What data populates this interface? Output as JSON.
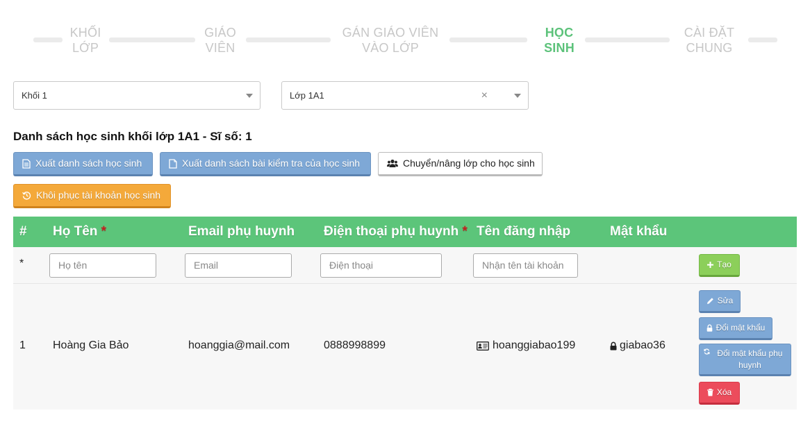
{
  "stepper": {
    "steps": [
      {
        "line1": "KHỐI",
        "line2": "LỚP"
      },
      {
        "line1": "GIÁO",
        "line2": "VIÊN"
      },
      {
        "line1": "GÁN GIÁO VIÊN",
        "line2": "VÀO LỚP"
      },
      {
        "line1": "HỌC",
        "line2": "SINH"
      },
      {
        "line1": "CÀI ĐẶT",
        "line2": "CHUNG"
      }
    ],
    "active_index": 3
  },
  "filters": {
    "grade_value": "Khối 1",
    "class_value": "Lớp 1A1",
    "clear_symbol": "×"
  },
  "list_title": "Danh sách học sinh khối lớp 1A1 - Sĩ số: 1",
  "toolbar": {
    "export_students": "Xuất danh sách học sinh",
    "export_tests": "Xuất danh sách bài kiểm tra của học sinh",
    "move_class": "Chuyển/nâng lớp cho học sinh",
    "restore_accounts": "Khôi phục tài khoản học sinh"
  },
  "table": {
    "headers": {
      "index": "#",
      "name": "Họ Tên",
      "email": "Email phụ huynh",
      "phone": "Điện thoại phụ huynh",
      "username": "Tên đăng nhập",
      "password": "Mật khẩu",
      "required_mark": "*"
    },
    "new_row": {
      "marker": "*",
      "name_placeholder": "Họ tên",
      "email_placeholder": "Email",
      "phone_placeholder": "Điện thoại",
      "username_placeholder": "Nhận tên tài khoản",
      "create_label": "Tạo"
    },
    "rows": [
      {
        "index": "1",
        "name": "Hoàng Gia Bảo",
        "email": "hoanggia@mail.com",
        "phone": "0888998899",
        "username": "hoanggiabao199",
        "password": "giabao36"
      }
    ],
    "actions": {
      "edit": "Sửa",
      "change_password": "Đổi mật khẩu",
      "change_parent_password": "Đổi mật khẩu phụ huynh",
      "delete": "Xóa"
    }
  },
  "colors": {
    "header_green": "#5cc57a",
    "active_step": "#5cc27a",
    "button_blue": "#7ea8d6",
    "button_orange": "#f4a93a",
    "button_green": "#8ccf5a",
    "button_red": "#ec4c5c"
  }
}
